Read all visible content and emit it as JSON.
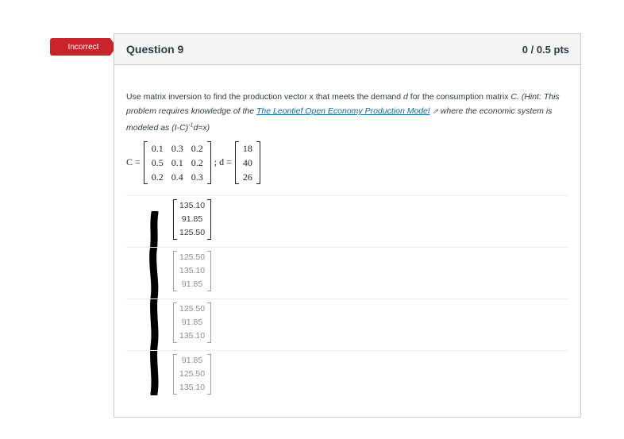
{
  "status_badge": "Incorrect",
  "question": {
    "title": "Question 9",
    "points": "0 / 0.5 pts"
  },
  "prompt": {
    "line1": "Use matrix inversion to find the production vector x that meets the demand ",
    "d_var": "d",
    "line1b": " for the consumption matrix ",
    "c_var": "C.",
    "hint_pre": "(Hint: This problem requires knowledge of the ",
    "link": "The Leontief Open Economy Production Model",
    "hint_post": " where the economic system is modeled as (I-C)",
    "sup": "-1",
    "hint_end": "d=x)"
  },
  "equation": {
    "c_label": "C =",
    "d_label": "; d =",
    "C": [
      [
        "0.1",
        "0.3",
        "0.2"
      ],
      [
        "0.5",
        "0.1",
        "0.2"
      ],
      [
        "0.2",
        "0.4",
        "0.3"
      ]
    ],
    "d": [
      "18",
      "40",
      "26"
    ]
  },
  "answers": [
    [
      "135.10",
      "91.85",
      "125.50"
    ],
    [
      "125.50",
      "135.10",
      "91.85"
    ],
    [
      "125.50",
      "91.85",
      "135.10"
    ],
    [
      "91.85",
      "125.50",
      "135.10"
    ]
  ]
}
